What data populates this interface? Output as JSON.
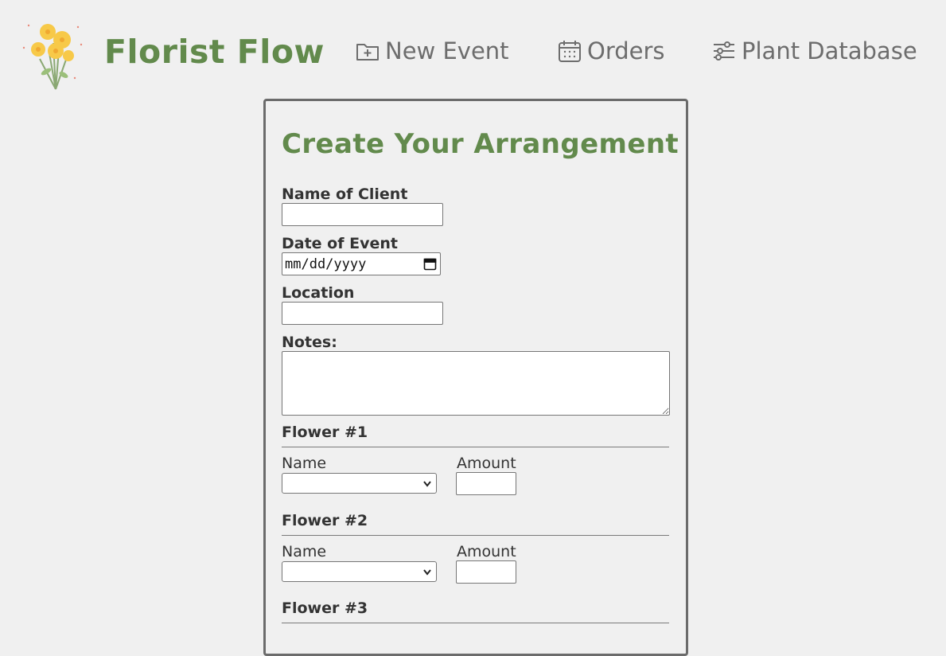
{
  "header": {
    "brand": "Florist Flow",
    "nav": {
      "new_event": "New Event",
      "orders": "Orders",
      "plant_database": "Plant Database"
    }
  },
  "form": {
    "title": "Create Your Arrangement",
    "client_label": "Name of Client",
    "client_value": "",
    "date_label": "Date of Event",
    "date_placeholder": "mm/dd/yyyy",
    "location_label": "Location",
    "location_value": "",
    "notes_label": "Notes:",
    "notes_value": "",
    "flowers": [
      {
        "title": "Flower #1",
        "name_label": "Name",
        "amount_label": "Amount",
        "name_value": "",
        "amount_value": ""
      },
      {
        "title": "Flower #2",
        "name_label": "Name",
        "amount_label": "Amount",
        "name_value": "",
        "amount_value": ""
      },
      {
        "title": "Flower #3"
      }
    ]
  },
  "colors": {
    "brand_green": "#628a4c",
    "nav_gray": "#6d6d6d",
    "background": "#f0f0f0"
  },
  "icons": {
    "logo": "yellow-flower-bouquet-logo",
    "new_event": "folder-plus-icon",
    "orders": "calendar-icon",
    "plant_database": "sliders-icon",
    "date_picker": "calendar-icon"
  }
}
